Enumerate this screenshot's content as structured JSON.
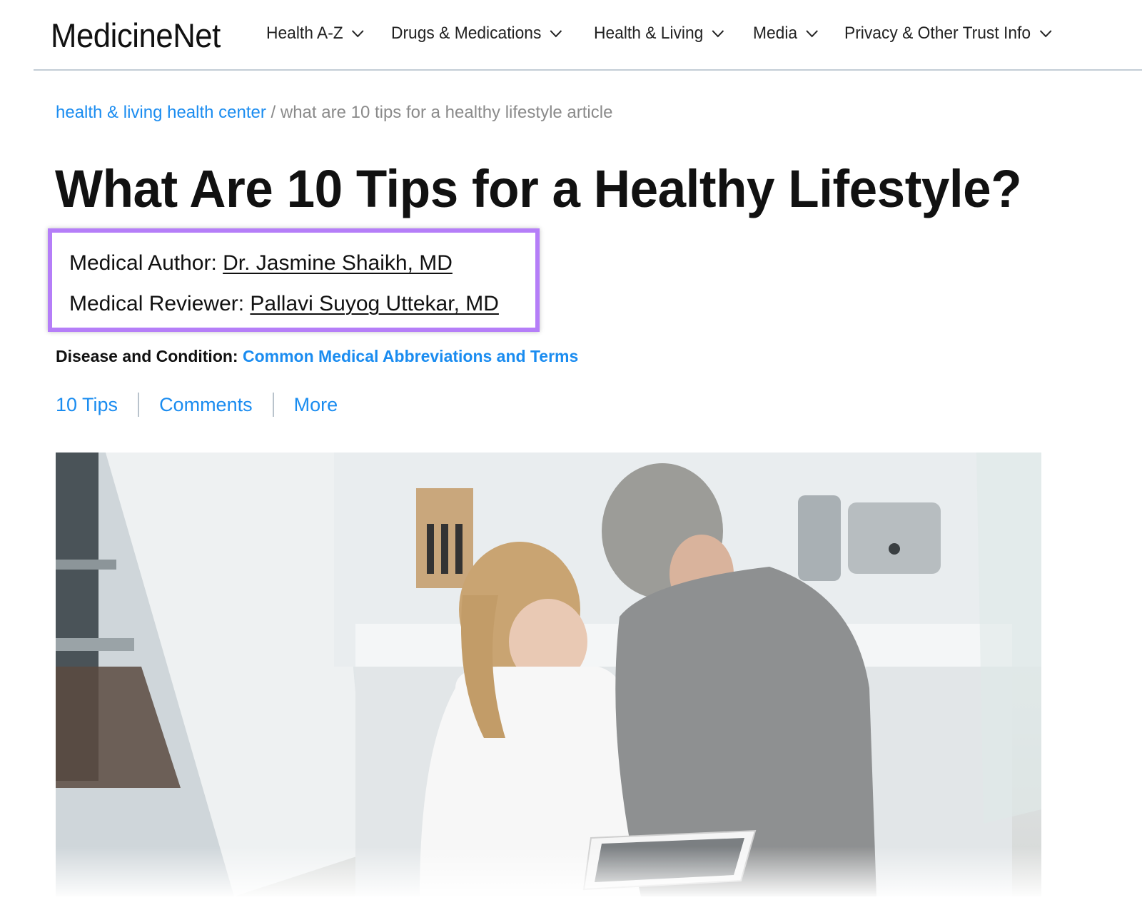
{
  "header": {
    "logo": "MedicineNet",
    "nav": [
      {
        "label": "Health A-Z",
        "icon": "chevron-down-icon"
      },
      {
        "label": "Drugs & Medications",
        "icon": "chevron-down-icon"
      },
      {
        "label": "Health & Living",
        "icon": "chevron-down-icon"
      },
      {
        "label": "Media",
        "icon": "chevron-down-icon"
      },
      {
        "label": "Privacy & Other Trust Info",
        "icon": "chevron-down-icon"
      }
    ]
  },
  "breadcrumb": {
    "link": "health & living health center",
    "separator": " / ",
    "current": "what are 10 tips for a healthy lifestyle article"
  },
  "article": {
    "title": "What Are 10 Tips for a Healthy Lifestyle?",
    "author_label": "Medical Author: ",
    "author_name": "Dr. Jasmine Shaikh, MD",
    "reviewer_label": "Medical Reviewer: ",
    "reviewer_name": "Pallavi Suyog Uttekar, MD",
    "disease_label": "Disease and Condition: ",
    "disease_link": "Common Medical Abbreviations and Terms",
    "anchors": [
      "10 Tips",
      "Comments",
      "More"
    ],
    "hero_image": "couple-looking-at-tablet-in-kitchen-photo"
  },
  "colors": {
    "link_blue": "#1a8cf0",
    "highlight_border": "#b57ef8",
    "header_rule": "#c3cdd6"
  }
}
